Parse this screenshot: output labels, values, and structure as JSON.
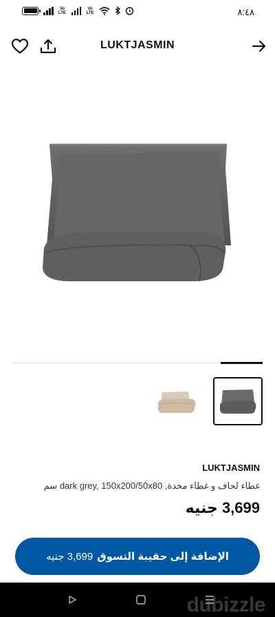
{
  "status_bar": {
    "time": "٨:٤٨",
    "signal_icons": [
      "battery-icon",
      "signal-icon",
      "wifi-icon",
      "bluetooth-icon",
      "alarm-icon"
    ],
    "network_label": "Vo LTE"
  },
  "header": {
    "title": "LUKTJASMIN",
    "icons": [
      "heart-icon",
      "share-icon",
      "arrow-right-icon"
    ]
  },
  "gallery": {
    "main_image": "grey-duvet-cover-set",
    "thumbnails": [
      "beige-duvet-cover-set",
      "grey-duvet-cover-set"
    ],
    "selected_index": 1
  },
  "product": {
    "brand": "LUKTJASMIN",
    "description": "غطاء لحاف و غطاء مخدة, dark grey, 150x200/50x80 سم",
    "price": "3,699 جنيه"
  },
  "cta": {
    "label": "الإضافة إلى حقيبة التسوق",
    "price": "3,699 جنيه"
  },
  "colors": {
    "accent": "#0058a3",
    "text": "#111111",
    "navbar": "#000000"
  },
  "watermark": "dubizzle"
}
